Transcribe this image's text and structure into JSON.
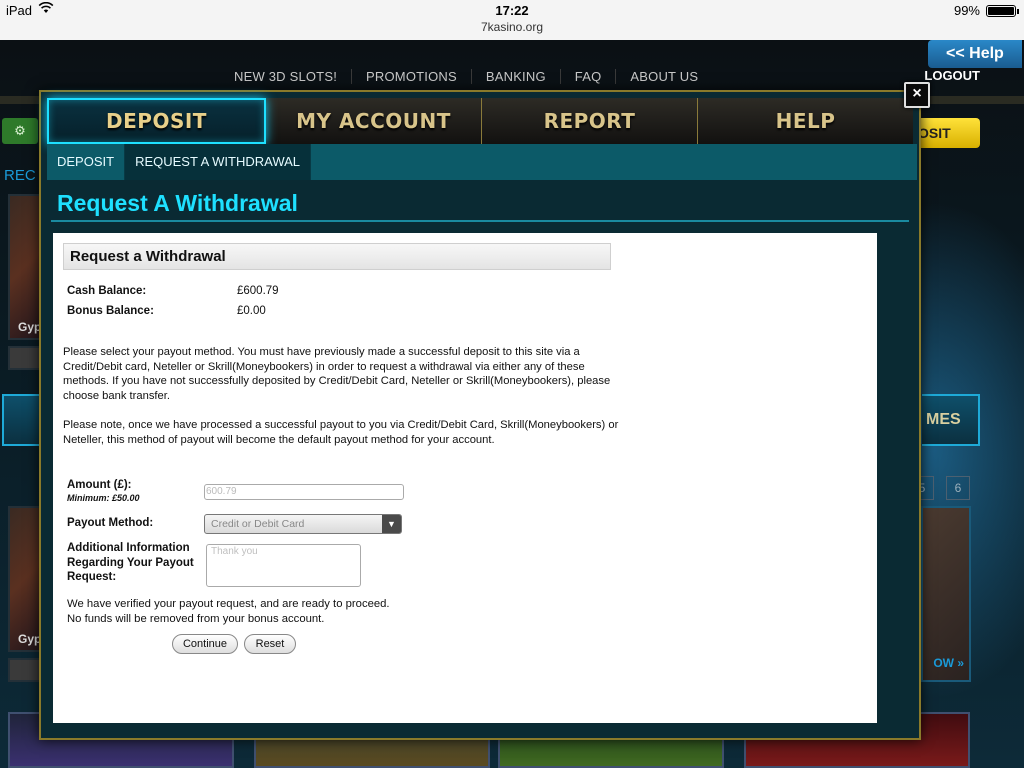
{
  "status_bar": {
    "device": "iPad",
    "wifi_icon": "wifi-icon",
    "time": "17:22",
    "url": "7kasino.org",
    "battery": "99%"
  },
  "site": {
    "nav": [
      "NEW 3D SLOTS!",
      "PROMOTIONS",
      "BANKING",
      "FAQ",
      "ABOUT US"
    ],
    "help_tab": "<< Help",
    "logout": "LOGOUT",
    "deposit_partial": "OSIT",
    "recent_partial": "REC",
    "games_partial": "MES",
    "tile_label_1": "Gyp",
    "tile_label_2": "Gyp",
    "page_5": "5",
    "page_6": "6",
    "now_link": "OW »"
  },
  "modal": {
    "close_label": "×",
    "tabs": [
      {
        "label": "DEPOSIT",
        "active": true
      },
      {
        "label": "MY ACCOUNT",
        "active": false
      },
      {
        "label": "REPORT",
        "active": false
      },
      {
        "label": "HELP",
        "active": false
      }
    ],
    "subtabs": [
      {
        "label": "DEPOSIT",
        "active": false
      },
      {
        "label": "REQUEST A WITHDRAWAL",
        "active": true
      }
    ],
    "title": "Request A Withdrawal",
    "panel": {
      "heading": "Request a Withdrawal",
      "cash_balance_label": "Cash Balance:",
      "cash_balance_value": "£600.79",
      "bonus_balance_label": "Bonus Balance:",
      "bonus_balance_value": "£0.00",
      "para1": "Please select your payout method. You must have previously made a successful deposit to this site via a Credit/Debit card, Neteller or Skrill(Moneybookers) in order to request a withdrawal via either any of these methods. If you have not successfully deposited by Credit/Debit Card, Neteller or Skrill(Moneybookers), please choose bank transfer.",
      "para2": "Please note, once we have processed a successful payout to you via Credit/Debit Card, Skrill(Moneybookers) or Neteller, this method of payout will become the default payout method for your account.",
      "amount_label": "Amount (£):",
      "amount_minimum": "Minimum: £50.00",
      "amount_placeholder": "600.79",
      "payout_label": "Payout Method:",
      "payout_selected": "Credit or Debit Card",
      "additional_label": "Additional Information Regarding Your Payout Request:",
      "additional_placeholder": "Thank you",
      "verified_text": "We have verified your payout request, and are ready to proceed. No funds will be removed from your bonus account.",
      "continue_label": "Continue",
      "reset_label": "Reset"
    }
  }
}
